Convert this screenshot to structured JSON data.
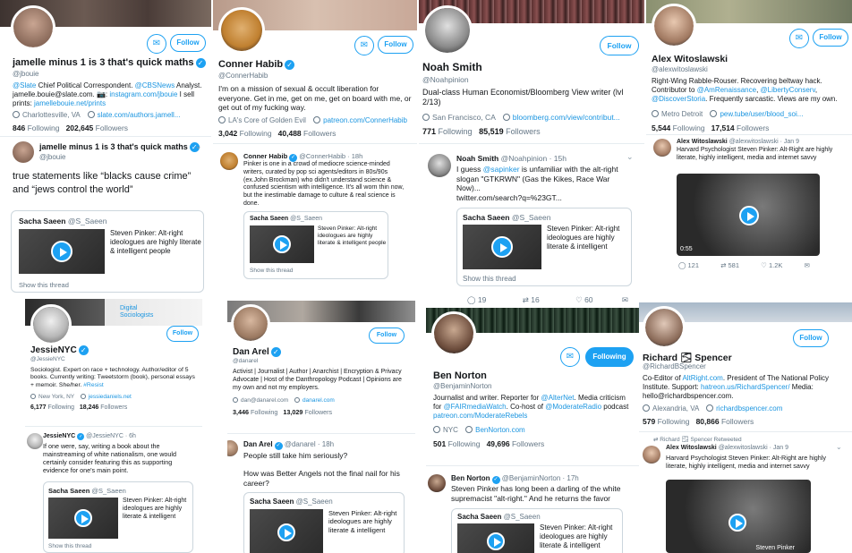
{
  "colors": {
    "accent": "#1da1f2",
    "link": "#1b95e0",
    "text": "#14171a",
    "muted": "#657786"
  },
  "p1": {
    "name": "jamelle minus 1 is 3 that's quick maths",
    "handle": "@jbouie",
    "bio1": "@Slate",
    "bio2": " Chief Political Correspondent. ",
    "bio3": "@CBSNews",
    "bio4": " Analyst. jamelle.bouie@slate.com. 📷: ",
    "bio5": "instagram.com/jbouie",
    "bio6": " I sell prints: ",
    "bio7": "jamellebouie.net/prints",
    "location": "Charlottesville, VA",
    "url": "slate.com/authors.jamell...",
    "following": "846",
    "following_label": "Following",
    "followers": "202,645",
    "followers_label": "Followers",
    "follow": "Follow",
    "tweet": {
      "name": "jamelle minus 1 is 3 that's quick maths",
      "handle": "@jbouie",
      "text": "true statements like “blacks cause crime” and “jews control the world”",
      "card_name": "Sacha Saeen",
      "card_handle": "@S_Saeen",
      "card_text": "Steven Pinker: Alt-right ideologues are highly literate & intelligent people",
      "thread": "Show this thread"
    }
  },
  "p2": {
    "name": "Conner Habib",
    "handle": "@ConnerHabib",
    "bio": "I'm on a mission of sexual & occult liberation for everyone. Get in me, get on me, get on board with me, or get out of my fucking way.",
    "location": "LA's Core of Golden Evil",
    "url": "patreon.com/ConnerHabib",
    "following": "3,042",
    "following_label": "Following",
    "followers": "40,488",
    "followers_label": "Followers",
    "follow": "Follow",
    "tweet": {
      "name": "Conner Habib",
      "handle": "@ConnerHabib · 18h",
      "text": "Pinker is one in a crowd of mediocre science-minded writers, curated by pop sci agents/editors in 80s/90s (ex.John Brockman) who didn't understand science & confused scientism with intelligence. It's all worn thin now, but the inestimable damage to culture & real science is done.",
      "card_name": "Sacha Saeen",
      "card_handle": "@S_Saeen",
      "card_text": "Steven Pinker: Alt-right ideologues are highly literate & intelligent people",
      "thread": "Show this thread"
    }
  },
  "p3": {
    "name": "Noah Smith",
    "handle": "@Noahpinion",
    "bio": "Dual-class Human Economist/Bloomberg View writer (lvl 2/13)",
    "location": "San Francisco, CA",
    "url": "bloomberg.com/view/contribut...",
    "following": "771",
    "following_label": "Following",
    "followers": "85,519",
    "followers_label": "Followers",
    "follow": "Follow",
    "tweet": {
      "name": "Noah Smith",
      "handle": "@Noahpinion · 15h",
      "text1": "I guess ",
      "text2": "@sapinker",
      "text3": " is unfamiliar with the alt-right slogan \"GTKRWN\" (Gas the Kikes, Race War Now)...",
      "link": "twitter.com/search?q=%23GT...",
      "card_name": "Sacha Saeen",
      "card_handle": "@S_Saeen",
      "card_text": "Steven Pinker: Alt-right ideologues are highly literate & intelligent",
      "thread": "Show this thread",
      "replies": "19",
      "retweets": "16",
      "likes": "60"
    }
  },
  "p4": {
    "name": "Alex Witoslawski",
    "handle": "@alexwitoslawski",
    "bio1": "Right-Wing Rabble-Rouser. Recovering beltway hack. Contributor to ",
    "bio2": "@AmRenaissance",
    "bio3": ", ",
    "bio4": "@LibertyConserv",
    "bio5": ", ",
    "bio6": "@DiscoverStoria",
    "bio7": ". Frequently sarcastic. Views are my own.",
    "location": "Metro Detroit",
    "url": "pew.tube/user/blood_soi...",
    "following": "5,544",
    "following_label": "Following",
    "followers": "17,514",
    "followers_label": "Followers",
    "follow": "Follow",
    "tweet": {
      "name": "Alex Witoslawski",
      "handle": "@alexwitoslawski · Jan 9",
      "text": "Harvard Psychologist Steven Pinker: Alt-Right are highly literate, highly intelligent, media and internet savvy",
      "duration": "0:55",
      "replies": "121",
      "retweets": "581",
      "likes": "1.2K"
    }
  },
  "p5": {
    "name": "JessieNYC",
    "handle": "@JessieNYC",
    "bio1": "Sociologist. Expert on race + technology. Author/editor of 5 books. Currently writing: Tweetstorm (book), personal essays + memoir. She/her. ",
    "bio2": "#Resist",
    "location": "New York, NY",
    "url": "jessiedaniels.net",
    "following": "6,177",
    "following_label": "Following",
    "followers": "18,246",
    "followers_label": "Followers",
    "follow": "Follow",
    "banner_text": "Digital Sociologists",
    "tweet": {
      "name": "JessieNYC",
      "handle": "@JessieNYC · 6h",
      "text": "If one were, say, writing a book about the mainstreaming of white nationalism, one would certainly consider featuring this as supporting evidence for one's main point.",
      "card_name": "Sacha Saeen",
      "card_handle": "@S_Saeen",
      "card_text": "Steven Pinker: Alt-right ideologues are highly literate & intelligent",
      "thread": "Show this thread"
    }
  },
  "p6": {
    "name": "Dan Arel",
    "handle": "@danarel",
    "bio": "Activist | Journalist | Author | Anarchist | Encryption & Privacy Advocate | Host of the Danthropology Podcast | Opinions are my own and not my employers.",
    "location": "dan@danarel.com",
    "url": "danarel.com",
    "following": "3,446",
    "following_label": "Following",
    "followers": "13,029",
    "followers_label": "Followers",
    "follow": "Follow",
    "tweet": {
      "name": "Dan Arel",
      "handle": "@danarel · 18h",
      "text1": "People still take him seriously?",
      "text2": "How was Better Angels not the final nail for his career?",
      "card_name": "Sacha Saeen",
      "card_handle": "@S_Saeen",
      "card_text": "Steven Pinker: Alt-right ideologues are highly literate & intelligent"
    }
  },
  "p7": {
    "name": "Ben Norton",
    "handle": "@BenjaminNorton",
    "bio1": "Journalist and writer. Reporter for ",
    "bio2": "@AlterNet",
    "bio3": ". Media criticism for ",
    "bio4": "@FAIRmediaWatch",
    "bio5": ". Co-host of ",
    "bio6": "@ModerateRadio",
    "bio7": " podcast ",
    "bio8": "patreon.com/ModerateRebels",
    "location": "NYC",
    "url": "BenNorton.com",
    "following": "501",
    "following_label": "Following",
    "followers": "49,696",
    "followers_label": "Followers",
    "follow": "Following",
    "tweet": {
      "name": "Ben Norton",
      "handle": "@BenjaminNorton · 17h",
      "text": "Steven Pinker has long been a darling of the white supremacist \"alt-right.\" And he returns the favor",
      "card_name": "Sacha Saeen",
      "card_handle": "@S_Saeen",
      "card_text": "Steven Pinker: Alt-right ideologues are highly literate & intelligent"
    }
  },
  "p8": {
    "name": "Richard 🌫 Spencer",
    "handle": "@RichardBSpencer",
    "bio1": "Co-Editor of ",
    "bio2": "AltRight.com",
    "bio3": ". President of The National Policy Institute. Support: ",
    "bio4": "hatreon.us/RichardSpencer/",
    "bio5": " Media: hello@richardbspencer.com.",
    "location": "Alexandria, VA",
    "url": "richardbspencer.com",
    "following": "579",
    "following_label": "Following",
    "followers": "80,866",
    "followers_label": "Followers",
    "follow": "Follow",
    "tweet": {
      "retweeted": "Richard 🌫 Spencer Retweeted",
      "name": "Alex Witoslawski",
      "handle": "@alexwitoslawski · Jan 9",
      "text": "Harvard Psychologist Steven Pinker: Alt-Right are highly literate, highly intelligent, media and internet savvy",
      "video_name": "Steven Pinker"
    }
  }
}
